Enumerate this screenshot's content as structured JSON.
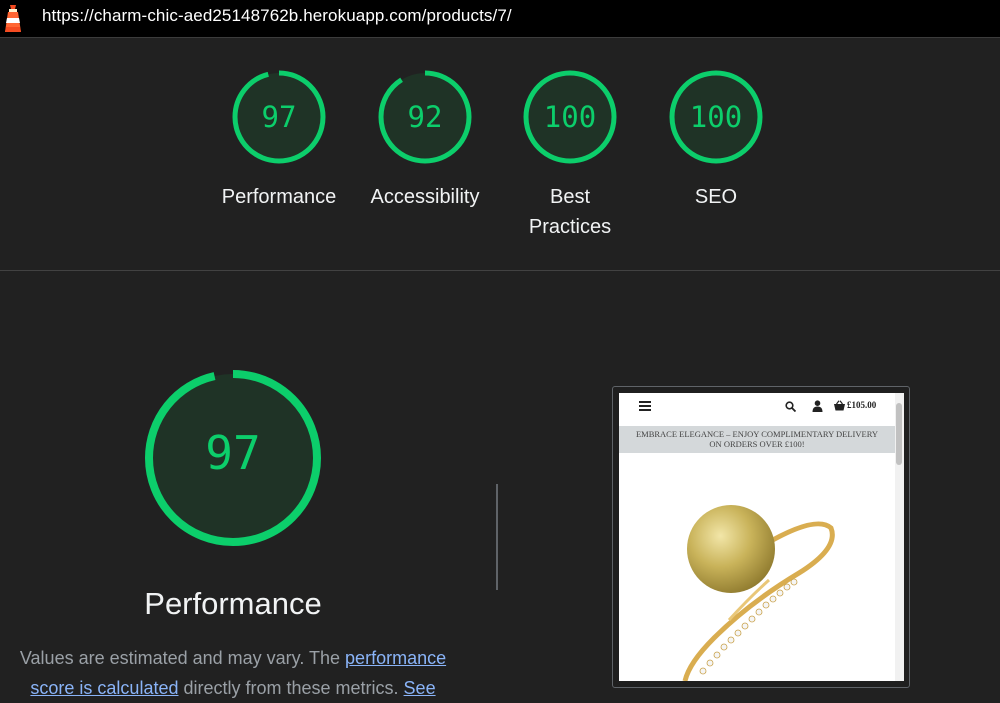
{
  "topbar": {
    "url": "https://charm-chic-aed25148762b.herokuapp.com/products/7/",
    "logo_icon": "lighthouse-icon"
  },
  "colors": {
    "pass": "#0cce6b",
    "background": "#212121",
    "link": "#8ab4f8"
  },
  "summary": [
    {
      "score": "97",
      "label": "Performance"
    },
    {
      "score": "92",
      "label": "Accessibility"
    },
    {
      "score": "100",
      "label": "Best Practices"
    },
    {
      "score": "100",
      "label": "SEO"
    }
  ],
  "performance": {
    "score": "97",
    "title": "Performance",
    "desc_prefix": "Values are estimated and may vary. The ",
    "desc_link1": "performance score is calculated",
    "desc_middle": " directly from these metrics. ",
    "desc_link2": "See"
  },
  "screenshot": {
    "cart_total": "£105.00",
    "banner_line1": "EMBRACE ELEGANCE – ENJOY COMPLIMENTARY DELIVERY",
    "banner_line2": "ON ORDERS OVER £100!",
    "image": "gold-pearl-ring"
  }
}
